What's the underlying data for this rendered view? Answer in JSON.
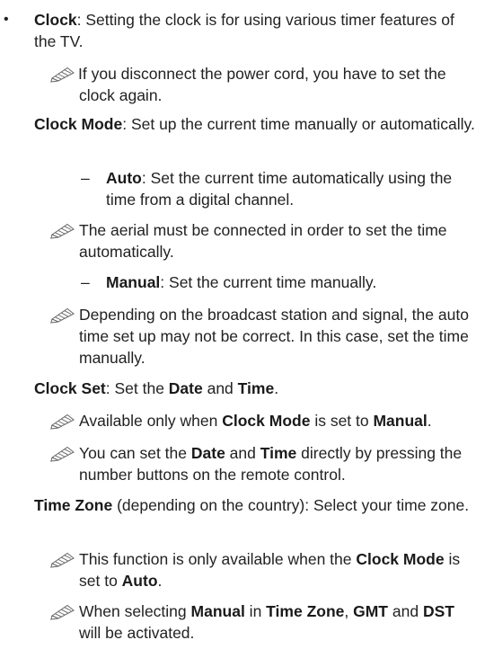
{
  "doc": {
    "bullet_marker": "•",
    "dash_marker": "–",
    "clock": {
      "title": "Clock",
      "desc": ": Setting the clock is for using various timer features of the TV.",
      "note": "If you disconnect the power cord, you have to set the clock again."
    },
    "clock_mode": {
      "title": "Clock Mode",
      "desc": ": Set up the current time manually or automatically.",
      "auto": {
        "label": "Auto",
        "desc": ": Set the current time automatically using the time from a digital channel."
      },
      "auto_note": "The aerial must be connected in order to set the time automatically.",
      "manual": {
        "label": "Manual",
        "desc": ": Set the current time manually."
      },
      "manual_note": "Depending on the broadcast station and signal, the auto time set up may not be correct. In this case, set the time manually."
    },
    "clock_set": {
      "title": "Clock Set",
      "desc_a": ": Set the ",
      "date": "Date",
      "and": " and ",
      "time": "Time",
      "end": ".",
      "note1": {
        "a": "Available only when ",
        "b": "Clock Mode",
        "c": " is set to ",
        "d": "Manual",
        "e": "."
      },
      "note2": {
        "a": "You can set the ",
        "b": "Date",
        "c": " and ",
        "d": "Time",
        "e": " directly by pressing the number buttons on the remote control."
      }
    },
    "time_zone": {
      "title": "Time Zone",
      "desc": " (depending on the country): Select your time zone.",
      "note1": {
        "a": "This function is only available when the ",
        "b": "Clock Mode",
        "c": " is set to ",
        "d": "Auto",
        "e": "."
      },
      "note2": {
        "a": "When selecting ",
        "b": "Manual",
        "c": " in ",
        "d": "Time Zone",
        "e": ", ",
        "f": "GMT",
        "g": " and ",
        "h": "DST",
        "i": " will be activated."
      }
    }
  }
}
